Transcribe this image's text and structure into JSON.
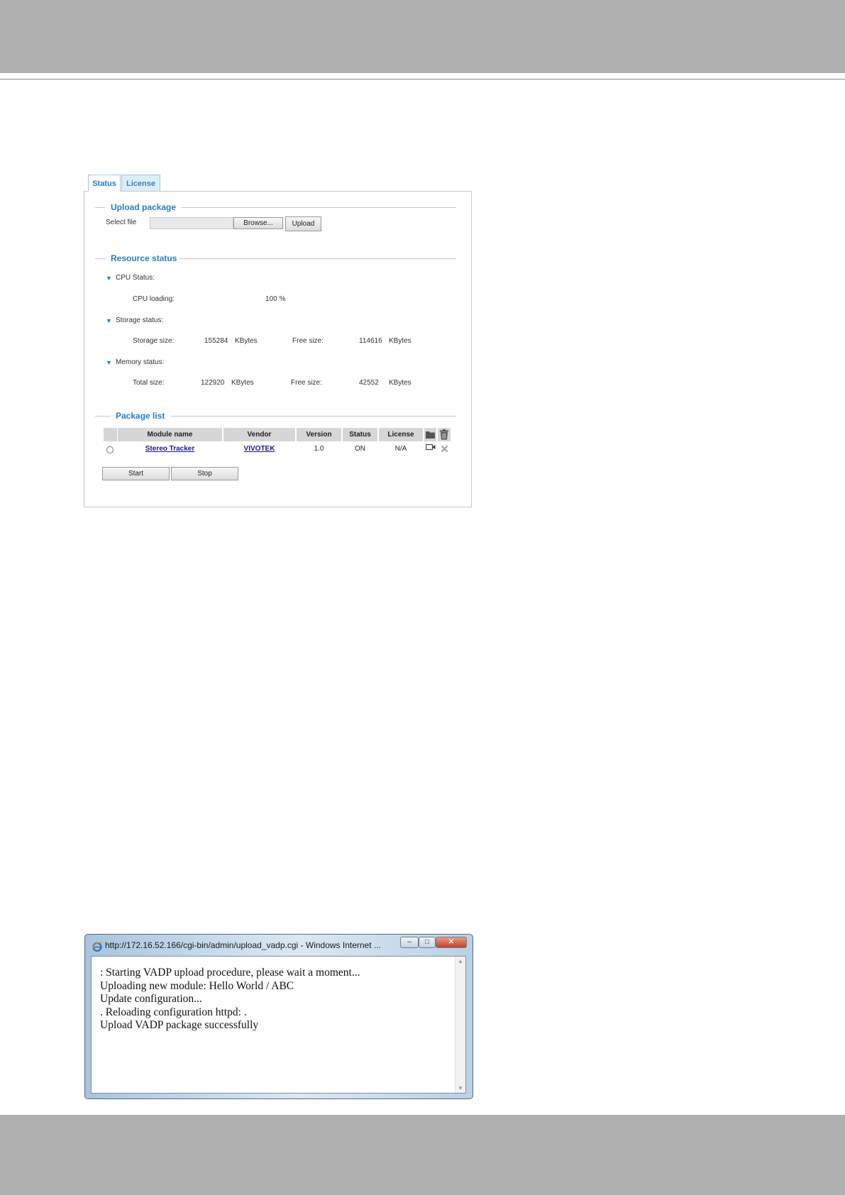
{
  "tabs": [
    {
      "label": "Status",
      "active": true
    },
    {
      "label": "License",
      "active": false
    }
  ],
  "upload_package": {
    "title": "Upload package",
    "select_file_label": "Select file",
    "file_value": "",
    "browse_label": "Browse...",
    "upload_label": "Upload"
  },
  "resource_status": {
    "title": "Resource status",
    "cpu": {
      "heading": "CPU Status:",
      "loading_label": "CPU loading:",
      "loading_value": "100 %"
    },
    "storage": {
      "heading": "Storage status:",
      "size_label": "Storage size:",
      "size_value": "155284",
      "size_unit": "KBytes",
      "free_label": "Free size:",
      "free_value": "114616",
      "free_unit": "KBytes"
    },
    "memory": {
      "heading": "Memory status:",
      "total_label": "Total size:",
      "total_value": "122920",
      "total_unit": "KBytes",
      "free_label": "Free size:",
      "free_value": "42552",
      "free_unit": "KBytes"
    }
  },
  "package_list": {
    "title": "Package list",
    "columns": [
      "Module name",
      "Vendor",
      "Version",
      "Status",
      "License"
    ],
    "rows": [
      {
        "module_name": "Stereo Tracker",
        "vendor": "VIVOTEK",
        "version": "1.0",
        "status": "ON",
        "license": "N/A"
      }
    ],
    "start_label": "Start",
    "stop_label": "Stop"
  },
  "popup": {
    "title": "http://172.16.52.166/cgi-bin/admin/upload_vadp.cgi - Windows Internet ...",
    "lines": [
      ": Starting VADP upload procedure, please wait a moment...",
      "Uploading new module: Hello World / ABC",
      "Update configuration...",
      ". Reloading configuration httpd: .",
      "Upload VADP package successfully"
    ]
  },
  "colors": {
    "accent": "#2b7fc1",
    "link": "#1a1a8c",
    "band": "#b0b0b0"
  },
  "icons": [
    "folder-icon",
    "trash-icon",
    "camera-icon",
    "remove-icon",
    "ie-icon",
    "chevron-down-icon"
  ]
}
